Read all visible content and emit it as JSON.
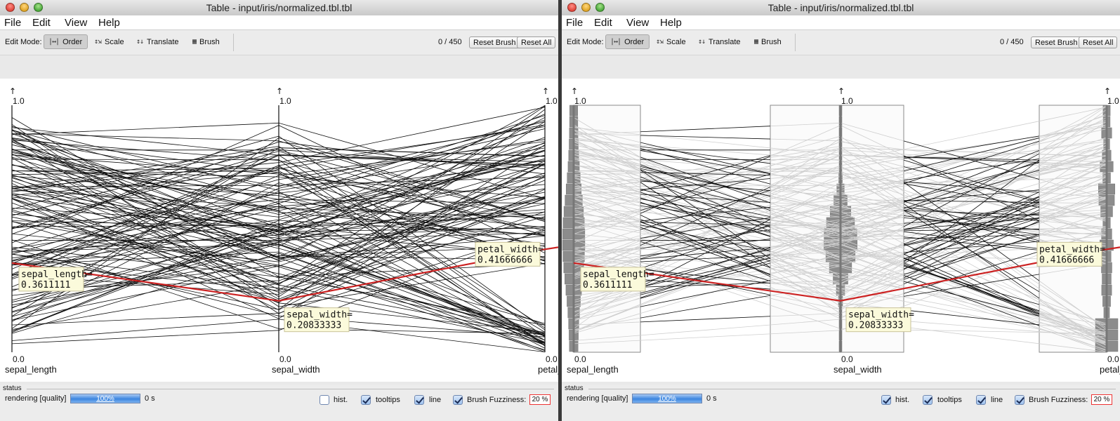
{
  "windows": [
    {
      "title": "Table - input/iris/normalized.tbl.tbl",
      "menus": [
        "File",
        "Edit",
        "View",
        "Help"
      ],
      "toolbar": {
        "edit_mode_label": "Edit Mode:",
        "modes": [
          {
            "label": "Order",
            "icon": "order-icon",
            "selected": true
          },
          {
            "label": "Scale",
            "icon": "scale-icon",
            "selected": false
          },
          {
            "label": "Translate",
            "icon": "translate-icon",
            "selected": false
          },
          {
            "label": "Brush",
            "icon": "brush-icon",
            "selected": false
          }
        ],
        "selection_count": "0 / 450",
        "reset_brush": "Reset Brush",
        "reset_all": "Reset All"
      },
      "plot": {
        "axes": [
          {
            "name": "sepal_length",
            "top": "1.0",
            "bottom": "0.0",
            "arrow": "↑"
          },
          {
            "name": "sepal_width",
            "top": "1.0",
            "bottom": "0.0",
            "arrow": "↑"
          },
          {
            "name": "petal_width",
            "top": "1.0",
            "bottom": "0.0",
            "arrow": "↑"
          }
        ],
        "highlighted_record": [
          0.3611111,
          0.20833333,
          0.41666666
        ],
        "highlight_color": "#cc2222",
        "tooltips": [
          {
            "line1": "sepal_length=",
            "line2": "0.3611111"
          },
          {
            "line1": "sepal_width=",
            "line2": "0.20833333"
          },
          {
            "line1": "petal_width=",
            "line2": "0.41666666"
          }
        ]
      },
      "status": {
        "title": "status",
        "rendering_label": "rendering [quality]",
        "progress": "100%",
        "elapsed": "0 s",
        "hist": {
          "label": "hist.",
          "checked": false
        },
        "tooltips": {
          "label": "tooltips",
          "checked": true
        },
        "line": {
          "label": "line",
          "checked": true
        },
        "brush_fuzziness_label": "Brush Fuzziness:",
        "brush_fuzziness": "20 %"
      }
    },
    {
      "title": "Table - input/iris/normalized.tbl.tbl",
      "menus": [
        "File",
        "Edit",
        "View",
        "Help"
      ],
      "toolbar": {
        "edit_mode_label": "Edit Mode:",
        "modes": [
          {
            "label": "Order",
            "icon": "order-icon",
            "selected": true
          },
          {
            "label": "Scale",
            "icon": "scale-icon",
            "selected": false
          },
          {
            "label": "Translate",
            "icon": "translate-icon",
            "selected": false
          },
          {
            "label": "Brush",
            "icon": "brush-icon",
            "selected": false
          }
        ],
        "selection_count": "0 / 450",
        "reset_brush": "Reset Brush",
        "reset_all": "Reset All"
      },
      "plot": {
        "axes": [
          {
            "name": "sepal_length",
            "top": "1.0",
            "bottom": "0.0",
            "arrow": "↑"
          },
          {
            "name": "sepal_width",
            "top": "1.0",
            "bottom": "0.0",
            "arrow": "↑"
          },
          {
            "name": "petal_width",
            "top": "1.0",
            "bottom": "0.0",
            "arrow": "↑"
          }
        ],
        "highlighted_record": [
          0.3611111,
          0.20833333,
          0.41666666
        ],
        "highlight_color": "#cc2222",
        "tooltips": [
          {
            "line1": "sepal_length=",
            "line2": "0.3611111"
          },
          {
            "line1": "sepal_width=",
            "line2": "0.20833333"
          },
          {
            "line1": "petal_width=",
            "line2": "0.41666666"
          }
        ]
      },
      "status": {
        "title": "status",
        "rendering_label": "rendering [quality]",
        "progress": "100%",
        "elapsed": "0 s",
        "hist": {
          "label": "hist.",
          "checked": true
        },
        "tooltips": {
          "label": "tooltips",
          "checked": true
        },
        "line": {
          "label": "line",
          "checked": true
        },
        "brush_fuzziness_label": "Brush Fuzziness:",
        "brush_fuzziness": "20 %"
      }
    }
  ]
}
